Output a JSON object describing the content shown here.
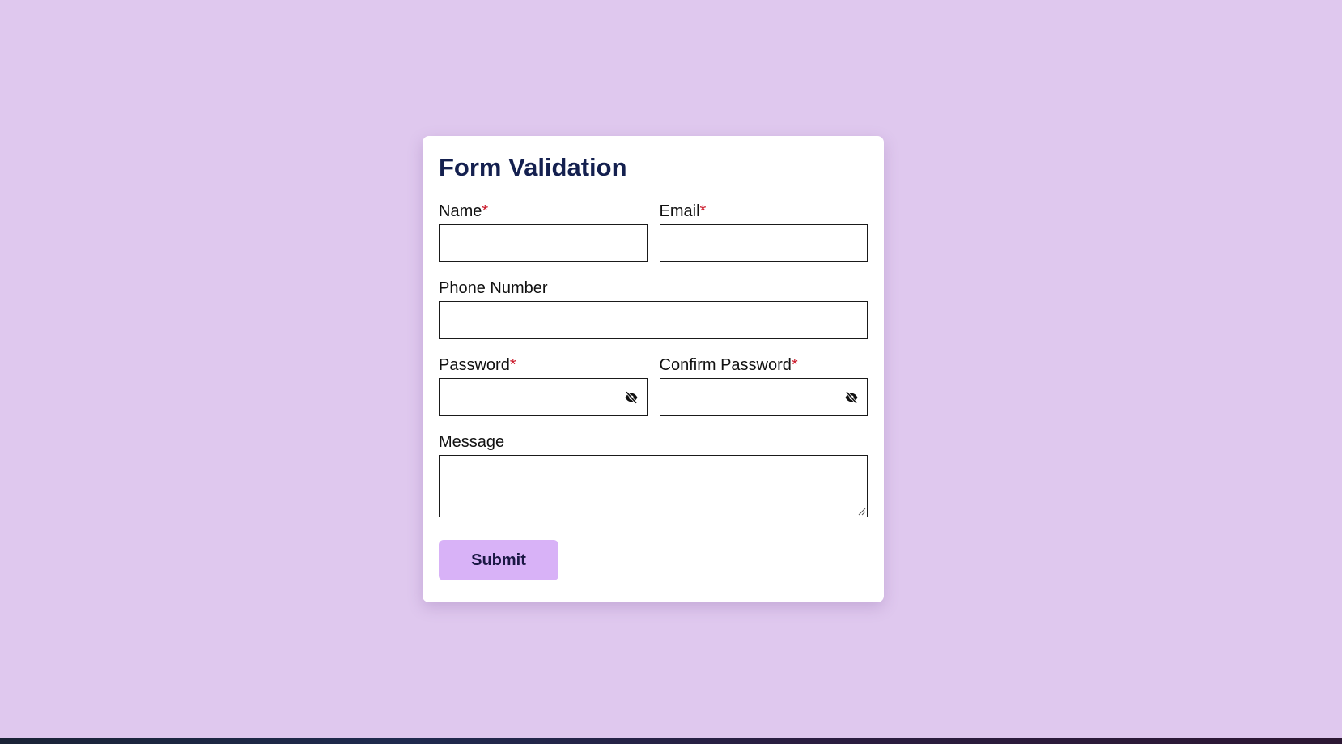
{
  "form": {
    "title": "Form Validation",
    "required_marker": "*",
    "fields": {
      "name": {
        "label": "Name",
        "value": "",
        "required": true
      },
      "email": {
        "label": "Email",
        "value": "",
        "required": true
      },
      "phone": {
        "label": "Phone Number",
        "value": "",
        "required": false
      },
      "password": {
        "label": "Password",
        "value": "",
        "required": true,
        "toggle_icon": "eye-slash-icon"
      },
      "confirm_password": {
        "label": "Confirm Password",
        "value": "",
        "required": true,
        "toggle_icon": "eye-slash-icon"
      },
      "message": {
        "label": "Message",
        "value": "",
        "required": false
      }
    },
    "submit_label": "Submit"
  },
  "colors": {
    "page_background": "#dfc8ee",
    "card_background": "#ffffff",
    "title": "#14204f",
    "required_marker": "#cc1b2c",
    "submit_background": "#d8b2f7",
    "submit_text": "#1a1744"
  }
}
